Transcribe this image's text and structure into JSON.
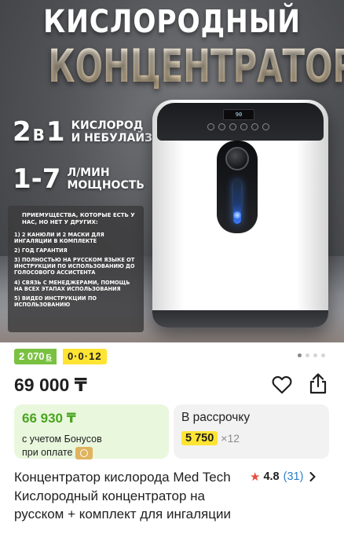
{
  "banner": {
    "title_line1": "КИСЛОРОДНЫЙ",
    "title_line2": "КОНЦЕНТРАТОР",
    "spec1_big": "2",
    "spec1_mid": "В",
    "spec1_big2": "1",
    "spec1_text_l1": "КИСЛОРОД",
    "spec1_text_l2": "И НЕБУЛАЙЗЕР",
    "spec2_big": "1-7",
    "spec2_text_l1": "Л/МИН",
    "spec2_text_l2": "МОЩНОСТЬ",
    "advantages_heading": "ПРИЕМУЩЕСТВА, КОТОРЫЕ ЕСТЬ У НАС, НО НЕТ У ДРУГИХ:",
    "advantages": [
      "1) 2 КАНЮЛИ И 2 МАСКИ ДЛЯ ИНГАЛЯЦИИ В КОМПЛЕКТЕ",
      "2) ГОД ГАРАНТИЯ",
      "3) ПОЛНОСТЬЮ НА РУССКОМ ЯЗЫКЕ ОТ ИНСТРУКЦИИ ПО ИСПОЛЬЗОВАНИЮ ДО ГОЛОСОВОГО АССИСТЕНТА",
      "4) СВЯЗЬ С МЕНЕДЖЕРАМИ, ПОМОЩЬ НА ВСЕХ ЭТАПАХ ИСПОЛЬЗОВАНИЯ",
      "5) ВИДЕО ИНСТРУКЦИИ ПО ИСПОЛЬЗОВАНИЮ"
    ],
    "device_display": "90"
  },
  "badges": {
    "bonus_amount": "2 070",
    "bonus_unit": "Б",
    "installment": "0·0·12"
  },
  "gallery": {
    "count": 4,
    "active_index": 0
  },
  "price": {
    "main": "69 000 ₸"
  },
  "bonus_card": {
    "value": "66 930 ₸",
    "note_line1": "с учетом Бонусов",
    "note_line2": "при оплате"
  },
  "installment_card": {
    "title": "В рассрочку",
    "amount": "5 750",
    "multiplier": "×12"
  },
  "product": {
    "title": "Концентратор кислорода Med Tech Кислородный концентратор на русском + комплект для ингаляции",
    "rating": "4.8",
    "reviews": "(31)"
  },
  "colors": {
    "bonus_green": "#7ac142",
    "install_yellow": "#ffe433",
    "rating_star": "#e94c3d",
    "link_blue": "#2a7fc9"
  },
  "icons": {
    "favorite": "heart-icon",
    "share": "share-icon",
    "rating": "star-icon",
    "more": "chevron-right-icon"
  }
}
